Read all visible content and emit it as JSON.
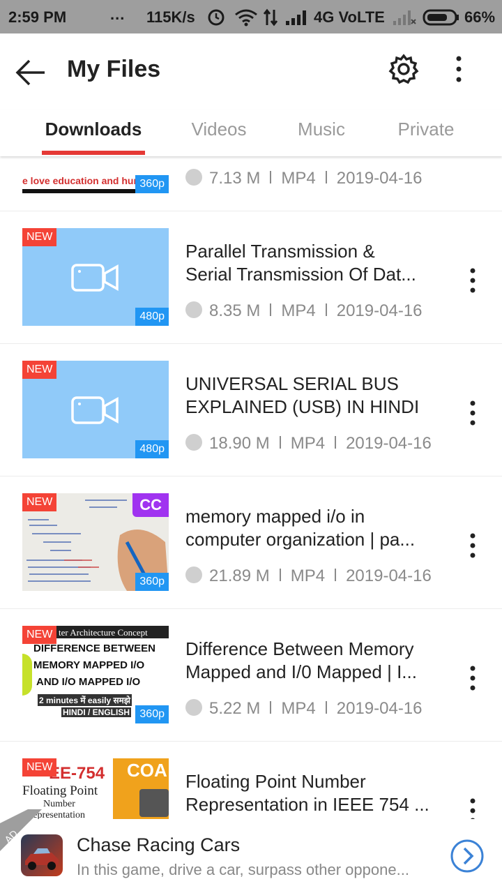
{
  "status_bar": {
    "time": "2:59 PM",
    "dots": "...",
    "speed": "115K/s",
    "network": "4G VoLTE",
    "battery": "66%"
  },
  "app_bar": {
    "title": "My Files"
  },
  "tabs": [
    {
      "label": "Downloads",
      "active": true
    },
    {
      "label": "Videos",
      "active": false
    },
    {
      "label": "Music",
      "active": false
    },
    {
      "label": "Private",
      "active": false
    }
  ],
  "items": [
    {
      "title_line1": "",
      "title_line2": "",
      "size": "7.13 M",
      "format": "MP4",
      "date": "2019-04-16",
      "badge_new": "",
      "resolution": "360p",
      "thumb_caption": "e love education and humanity",
      "thumb_style": "partial"
    },
    {
      "title_line1": "Parallel Transmission &",
      "title_line2": "Serial Transmission Of Dat...",
      "size": "8.35 M",
      "format": "MP4",
      "date": "2019-04-16",
      "badge_new": "NEW",
      "resolution": "480p",
      "thumb_style": "placeholder"
    },
    {
      "title_line1": "UNIVERSAL SERIAL BUS",
      "title_line2": "EXPLAINED (USB) IN HINDI",
      "size": "18.90 M",
      "format": "MP4",
      "date": "2019-04-16",
      "badge_new": "NEW",
      "resolution": "480p",
      "thumb_style": "placeholder"
    },
    {
      "title_line1": "memory mapped i/o in",
      "title_line2": "computer organization | pa...",
      "size": "21.89 M",
      "format": "MP4",
      "date": "2019-04-16",
      "badge_new": "NEW",
      "resolution": "360p",
      "badge_cc": "CC",
      "thumb_style": "whiteboard"
    },
    {
      "title_line1": "Difference Between Memory",
      "title_line2": "Mapped and I/0 Mapped | I...",
      "size": "5.22 M",
      "format": "MP4",
      "date": "2019-04-16",
      "badge_new": "NEW",
      "resolution": "360p",
      "thumb_style": "text",
      "thumb_lines": [
        "ter Architecture Concept",
        "DIFFERENCE BETWEEN",
        "MEMORY MAPPED I/O",
        "AND I/O MAPPED I/O",
        "2 minutes में easily समझे",
        "HINDI / ENGLISH"
      ]
    },
    {
      "title_line1": "Floating Point Number",
      "title_line2": "Representation in IEEE 754 ...",
      "size": "",
      "format": "",
      "date": "",
      "badge_new": "NEW",
      "resolution": "",
      "thumb_style": "ieee",
      "thumb_lines": [
        "EE-754",
        "COA",
        "Floating Point",
        "Number",
        "Representation"
      ]
    }
  ],
  "ad": {
    "title": "Chase Racing Cars",
    "description": "In this game, drive a car, surpass other oppone...",
    "corner_label": "AD"
  },
  "colors": {
    "accent_red": "#e53935",
    "new_badge": "#f44336",
    "res_badge": "#2196f3",
    "placeholder_thumb": "#90caf9",
    "cc_badge": "#a033f0",
    "ad_button": "#3b82d6"
  }
}
